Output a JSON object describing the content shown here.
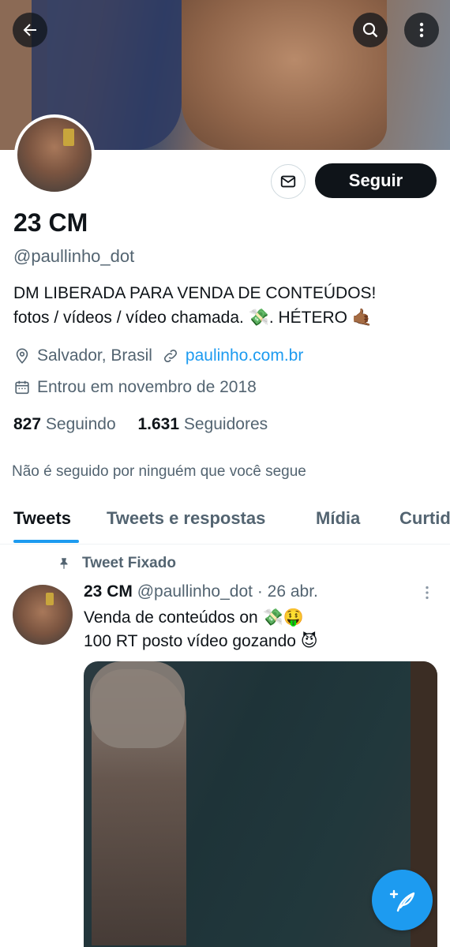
{
  "profile": {
    "name": "23 CM",
    "handle": "@paullinho_dot",
    "bio_line1": "DM LIBERADA PARA VENDA DE CONTEÚDOS!",
    "bio_line2": "fotos / vídeos / vídeo chamada. 💸. HÉTERO 🤙🏾",
    "location": "Salvador, Brasil",
    "website": "paulinho.com.br",
    "joined": "Entrou em novembro de 2018",
    "following_count": "827",
    "following_label": "Seguindo",
    "followers_count": "1.631",
    "followers_label": "Seguidores",
    "not_followed_note": "Não é seguido por ninguém que você segue"
  },
  "actions": {
    "follow_label": "Seguir"
  },
  "tabs": [
    "Tweets",
    "Tweets e respostas",
    "Mídia",
    "Curtidas"
  ],
  "pinned_tweet": {
    "pinned_label": "Tweet Fixado",
    "author_name": "23 CM",
    "author_handle": "@paullinho_dot",
    "date": "· 26 abr.",
    "text_line1": "Venda de conteúdos on 💸🤑",
    "text_line2": "100 RT posto vídeo gozando 😈"
  },
  "colors": {
    "accent": "#1d9bf0",
    "text_primary": "#0f1419",
    "text_secondary": "#536471"
  },
  "icons": {
    "back": "arrow-left-icon",
    "search": "search-icon",
    "more": "more-vertical-icon",
    "message": "envelope-icon",
    "location": "location-pin-icon",
    "link": "link-icon",
    "calendar": "calendar-icon",
    "pin": "pin-icon",
    "compose": "compose-tweet-icon"
  }
}
